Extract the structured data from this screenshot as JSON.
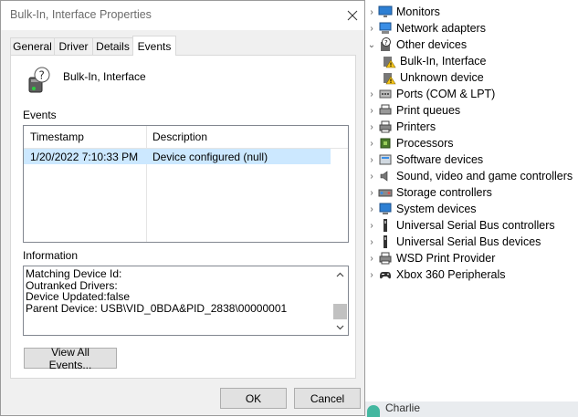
{
  "dialog": {
    "title": "Bulk-In, Interface Properties",
    "tabs": [
      "General",
      "Driver",
      "Details",
      "Events"
    ],
    "active_tab": "Events",
    "device_name": "Bulk-In, Interface",
    "events_label": "Events",
    "events_table": {
      "columns": [
        "Timestamp",
        "Description"
      ],
      "rows": [
        {
          "timestamp": "1/20/2022 7:10:33 PM",
          "description": "Device configured (null)"
        }
      ]
    },
    "information_label": "Information",
    "information_lines": [
      "Matching Device Id:",
      "Outranked Drivers:",
      "Device Updated:false",
      "Parent Device: USB\\VID_0BDA&PID_2838\\00000001"
    ],
    "view_all_events_label": "View All Events...",
    "ok_label": "OK",
    "cancel_label": "Cancel"
  },
  "device_tree": {
    "items": [
      {
        "label": "Monitors",
        "icon": "monitor-icon",
        "expander": "collapsed"
      },
      {
        "label": "Network adapters",
        "icon": "network-adapter-icon",
        "expander": "collapsed"
      },
      {
        "label": "Other devices",
        "icon": "unknown-device-icon",
        "expander": "expanded"
      },
      {
        "label": "Bulk-In, Interface",
        "icon": "warning-device-icon",
        "expander": "none"
      },
      {
        "label": "Unknown device",
        "icon": "warning-device-icon",
        "expander": "none"
      },
      {
        "label": "Ports (COM & LPT)",
        "icon": "port-icon",
        "expander": "collapsed"
      },
      {
        "label": "Print queues",
        "icon": "print-queue-icon",
        "expander": "collapsed"
      },
      {
        "label": "Printers",
        "icon": "printer-icon",
        "expander": "collapsed"
      },
      {
        "label": "Processors",
        "icon": "processor-icon",
        "expander": "collapsed"
      },
      {
        "label": "Software devices",
        "icon": "software-device-icon",
        "expander": "collapsed"
      },
      {
        "label": "Sound, video and game controllers",
        "icon": "speaker-icon",
        "expander": "collapsed"
      },
      {
        "label": "Storage controllers",
        "icon": "storage-controller-icon",
        "expander": "collapsed"
      },
      {
        "label": "System devices",
        "icon": "system-device-icon",
        "expander": "collapsed"
      },
      {
        "label": "Universal Serial Bus controllers",
        "icon": "usb-icon",
        "expander": "collapsed"
      },
      {
        "label": "Universal Serial Bus devices",
        "icon": "usb-icon",
        "expander": "collapsed"
      },
      {
        "label": "WSD Print Provider",
        "icon": "printer-icon",
        "expander": "collapsed"
      },
      {
        "label": "Xbox 360 Peripherals",
        "icon": "gamepad-icon",
        "expander": "collapsed"
      }
    ]
  },
  "taskbar": {
    "user_name": "Charlie"
  },
  "colors": {
    "selection": "#cce8ff",
    "dialog_bg": "#f0f0f0",
    "button_bg": "#e1e1e1",
    "warning": "#f5c518"
  }
}
